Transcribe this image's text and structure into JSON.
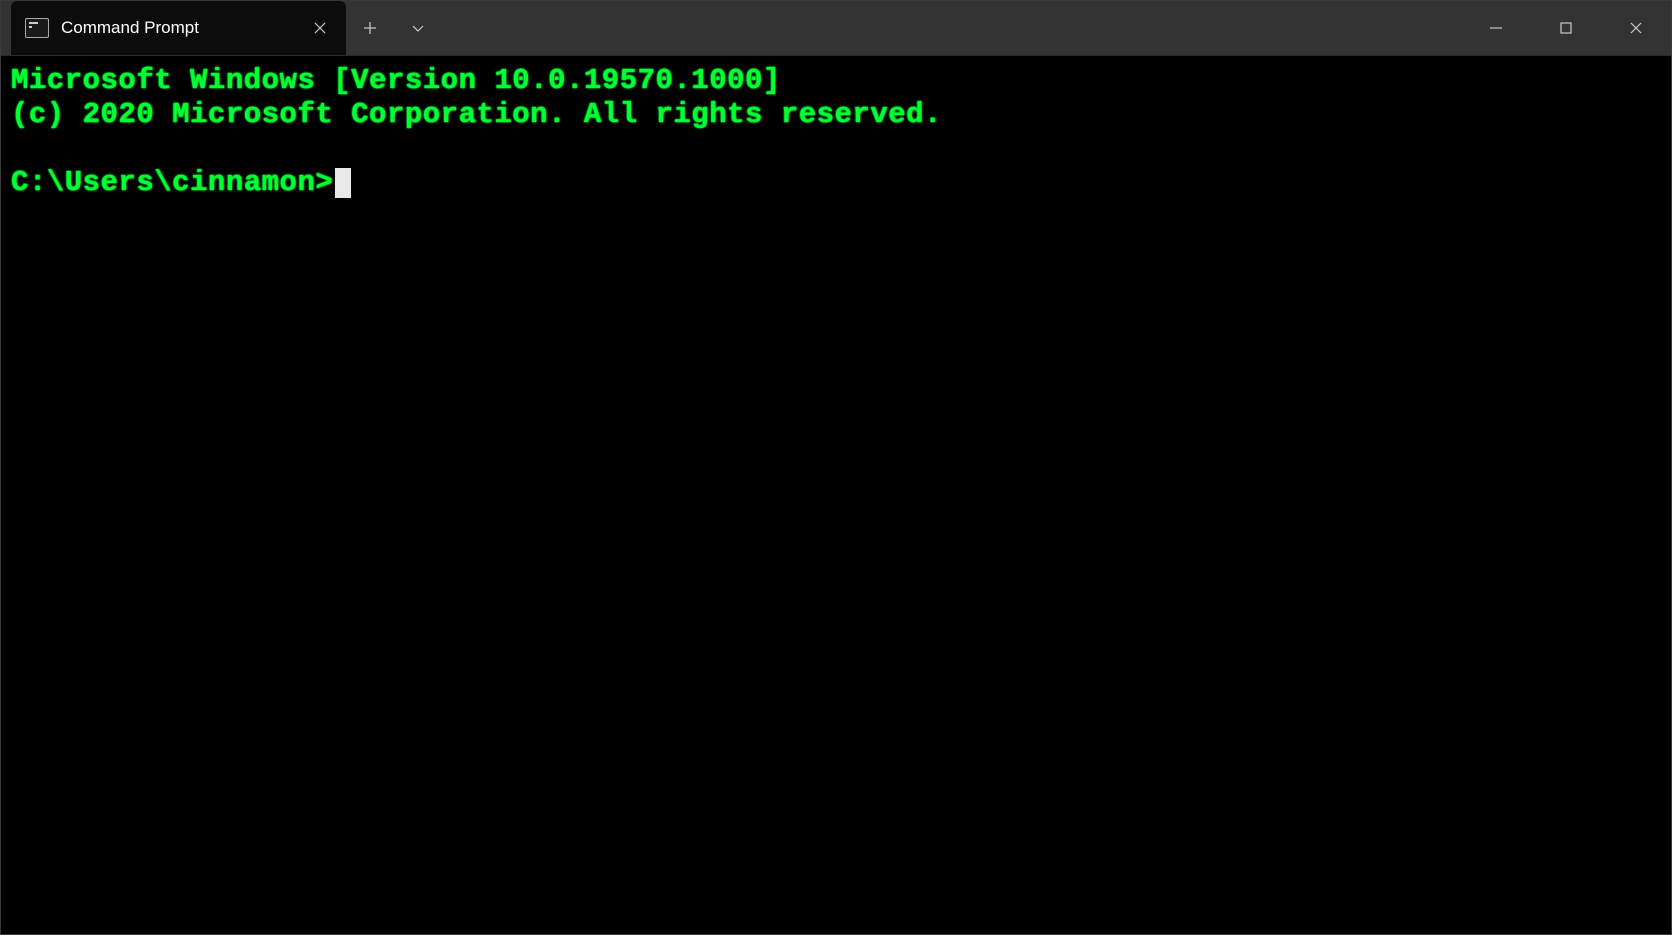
{
  "window": {
    "tab": {
      "title": "Command Prompt"
    }
  },
  "terminal": {
    "line1": "Microsoft Windows [Version 10.0.19570.1000]",
    "line2": "(c) 2020 Microsoft Corporation. All rights reserved.",
    "blank": "",
    "prompt": "C:\\Users\\cinnamon>",
    "text_color": "#00ff33",
    "background_color": "#000000"
  }
}
